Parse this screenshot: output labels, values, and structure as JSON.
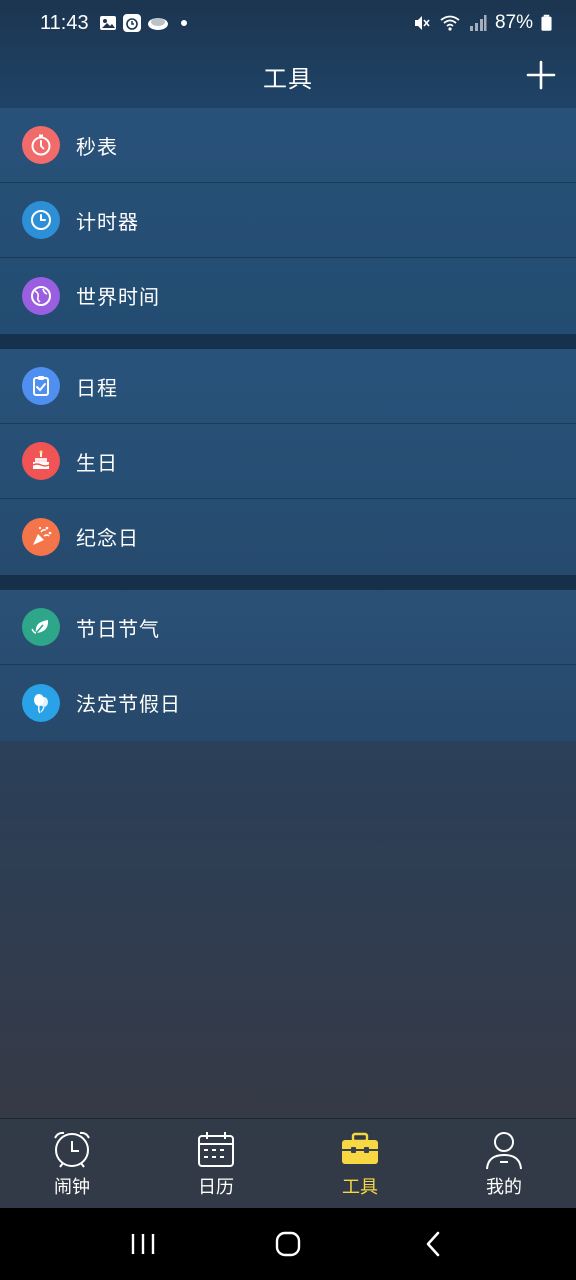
{
  "status_bar": {
    "time": "11:43",
    "battery": "87%"
  },
  "header": {
    "title": "工具",
    "add_icon": "plus-icon"
  },
  "groups": [
    {
      "items": [
        {
          "label": "秒表",
          "icon": "stopwatch-icon",
          "color": "#f26b6b"
        },
        {
          "label": "计时器",
          "icon": "timer-icon",
          "color": "#2d8fd6"
        },
        {
          "label": "世界时间",
          "icon": "globe-icon",
          "color": "#9a5fe0"
        }
      ]
    },
    {
      "items": [
        {
          "label": "日程",
          "icon": "schedule-icon",
          "color": "#4f8ff0"
        },
        {
          "label": "生日",
          "icon": "cake-icon",
          "color": "#f05454"
        },
        {
          "label": "纪念日",
          "icon": "confetti-icon",
          "color": "#f4754a"
        }
      ]
    },
    {
      "items": [
        {
          "label": "节日节气",
          "icon": "leaf-icon",
          "color": "#2ea689"
        },
        {
          "label": "法定节假日",
          "icon": "balloon-icon",
          "color": "#2aa2e8"
        }
      ]
    }
  ],
  "bottom_nav": {
    "items": [
      {
        "label": "闹钟",
        "icon": "alarm-clock-icon"
      },
      {
        "label": "日历",
        "icon": "calendar-icon"
      },
      {
        "label": "工具",
        "icon": "toolbox-icon",
        "active": true
      },
      {
        "label": "我的",
        "icon": "user-icon"
      }
    ],
    "active_color": "#f7d843"
  },
  "system_nav": {
    "recent": "recent-apps-icon",
    "home": "home-icon",
    "back": "back-icon"
  }
}
